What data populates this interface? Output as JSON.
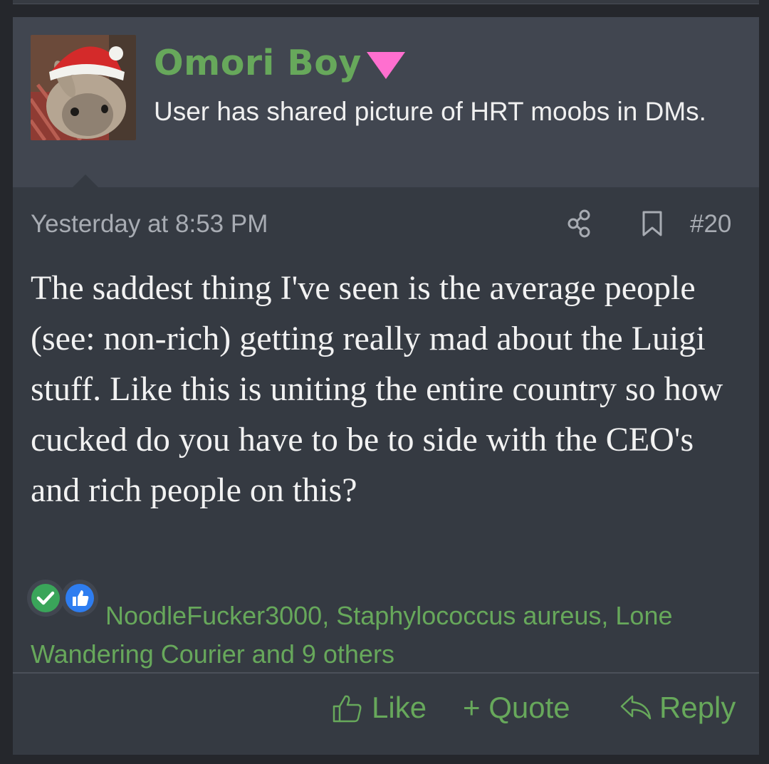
{
  "user": {
    "name": "Omori Boy",
    "badge_icon": "pink-triangle-icon",
    "badge_color": "#ff6fcf",
    "title": "User has shared picture of HRT moobs in DMs."
  },
  "post": {
    "timestamp": "Yesterday at 8:53 PM",
    "number": "#20",
    "message": "The saddest thing I've seen is the average people (see: non-rich) getting really mad about the Luigi stuff. Like this is uniting the entire country so how cucked do you have to be to side with the CEO's and rich people on this?"
  },
  "reactions": {
    "icons": [
      "check-reaction-icon",
      "like-reaction-icon"
    ],
    "text": "NoodleFucker3000, Staphylococcus aureus, Lone Wandering Courier and 9 others"
  },
  "actions": {
    "like": "Like",
    "quote": "+ Quote",
    "reply": "Reply"
  },
  "colors": {
    "accent_green": "#67a85b",
    "background": "#353a42",
    "user_block": "#414650",
    "text": "#f2f2f2",
    "muted": "#a8acb3"
  }
}
